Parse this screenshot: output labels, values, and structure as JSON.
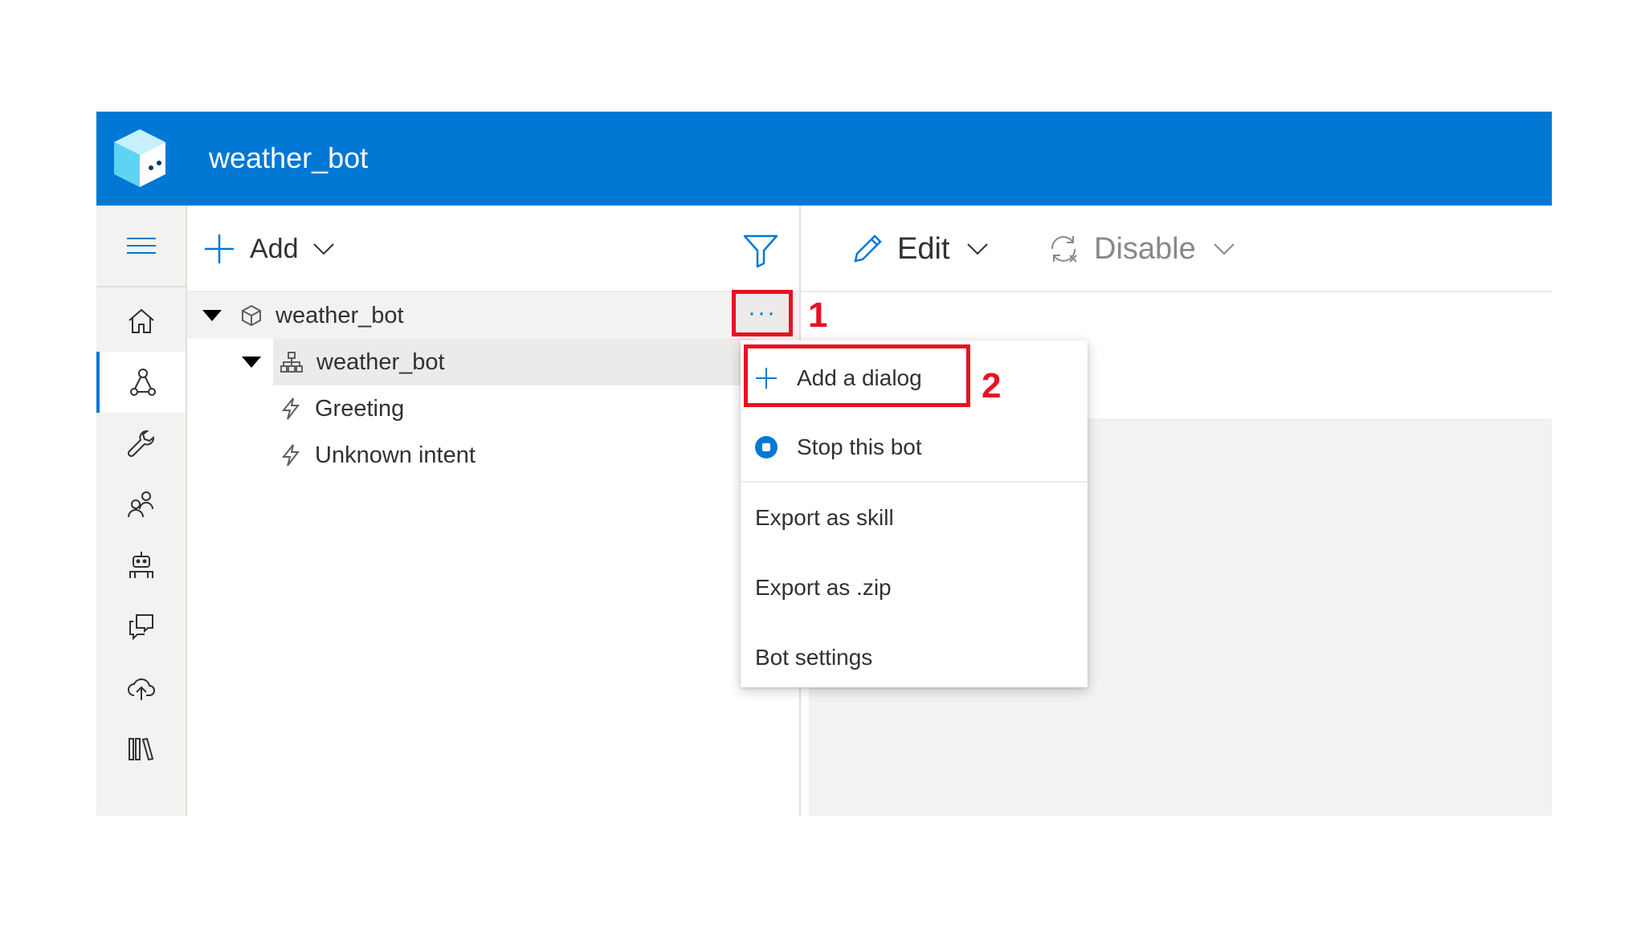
{
  "header": {
    "title": "weather_bot"
  },
  "nav": {
    "items": [
      {
        "name": "home-icon"
      },
      {
        "name": "design-icon",
        "selected": true
      },
      {
        "name": "wrench-icon"
      },
      {
        "name": "users-icon"
      },
      {
        "name": "bot-icon"
      },
      {
        "name": "chat-icon"
      },
      {
        "name": "cloud-upload-icon"
      },
      {
        "name": "library-icon"
      }
    ]
  },
  "explorer": {
    "add_label": "Add",
    "tree": {
      "bot": "weather_bot",
      "dialog": "weather_bot",
      "triggers": [
        "Greeting",
        "Unknown intent"
      ]
    },
    "more_label": "···"
  },
  "right_toolbar": {
    "edit_label": "Edit",
    "disable_label": "Disable"
  },
  "context_menu": {
    "items": [
      "Add a dialog",
      "Stop this bot",
      "Export as skill",
      "Export as .zip",
      "Bot settings"
    ]
  },
  "annotations": {
    "step1": "1",
    "step2": "2"
  },
  "colors": {
    "accent": "#0078d4",
    "highlight": "#e81123"
  }
}
